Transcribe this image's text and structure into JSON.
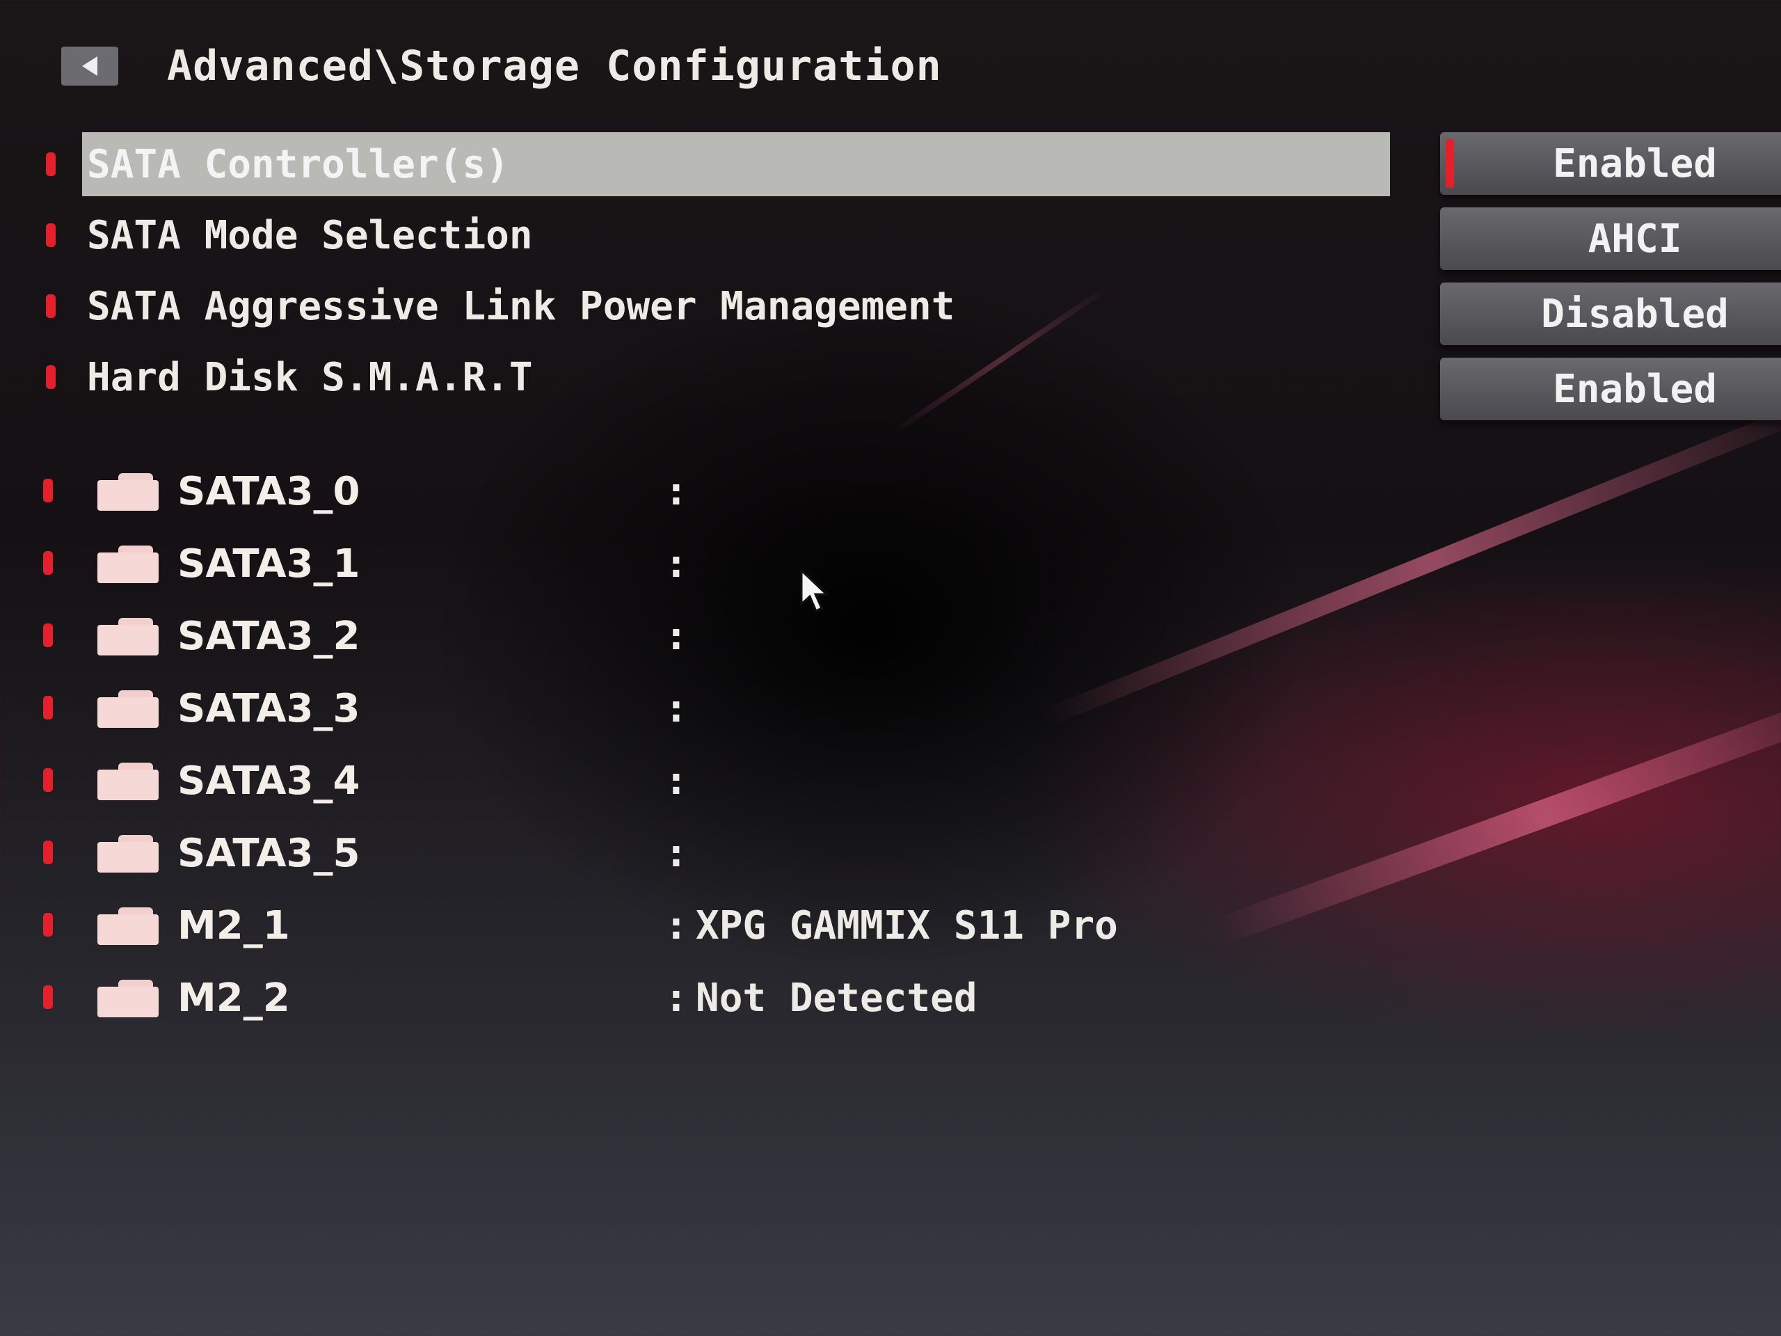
{
  "header": {
    "title": "Advanced\\Storage Configuration",
    "back_icon": "back-arrow-icon"
  },
  "settings": [
    {
      "label": "SATA Controller(s)",
      "value": "Enabled",
      "selected": true
    },
    {
      "label": "SATA Mode Selection",
      "value": "AHCI",
      "selected": false
    },
    {
      "label": "SATA Aggressive Link Power Management",
      "value": "Disabled",
      "selected": false
    },
    {
      "label": "Hard Disk S.M.A.R.T",
      "value": "Enabled",
      "selected": false
    }
  ],
  "drives": [
    {
      "name": "SATA3_0",
      "device": ""
    },
    {
      "name": "SATA3_1",
      "device": ""
    },
    {
      "name": "SATA3_2",
      "device": ""
    },
    {
      "name": "SATA3_3",
      "device": ""
    },
    {
      "name": "SATA3_4",
      "device": ""
    },
    {
      "name": "SATA3_5",
      "device": ""
    },
    {
      "name": "M2_1",
      "device": "XPG GAMMIX S11 Pro"
    },
    {
      "name": "M2_2",
      "device": "Not Detected"
    }
  ],
  "separator": ":",
  "colors": {
    "accent": "#e3202c",
    "selection_bar": "#b9b9b6",
    "value_button": "#5a5a5e",
    "text": "#ecebe6"
  }
}
